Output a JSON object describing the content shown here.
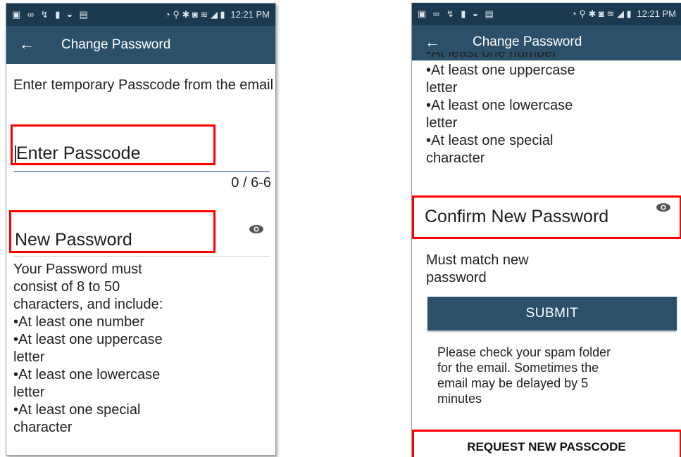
{
  "status_bar": {
    "left_icons": "▣ ∞ ↯ ▮ ◒ ▤",
    "right_icons": "◔ ⚲ ✱ ◙ ≋ ◢ ▮",
    "time": "12:21 PM"
  },
  "app_bar": {
    "back_icon": "←",
    "title": "Change Password"
  },
  "left_screen": {
    "instruction": "Enter temporary Passcode from the email",
    "passcode_placeholder": "Enter Passcode",
    "passcode_counter": "0 / 6-6",
    "new_password_placeholder": "New Password",
    "requirements": [
      "Your Password must",
      "consist of 8 to 50",
      "characters, and include:",
      "•At least one number",
      "•At least one uppercase",
      "letter",
      "•At least one lowercase",
      "letter",
      "•At least one special",
      "character"
    ]
  },
  "right_screen": {
    "scrolled_partial_line": "•At least one number",
    "requirements": [
      "•At least one uppercase",
      "letter",
      "•At least one lowercase",
      "letter",
      "•At least one special",
      "character"
    ],
    "confirm_placeholder": "Confirm New Password",
    "confirm_hint": [
      "Must match new",
      "password"
    ],
    "submit_label": "SUBMIT",
    "spam_note": [
      "Please check your spam folder",
      "for the email. Sometimes the",
      "email may be delayed by 5",
      "minutes"
    ],
    "request_label": "REQUEST NEW PASSCODE"
  },
  "colors": {
    "status_bar": "#1b394f",
    "app_bar": "#2c506a",
    "highlight": "#ff0000"
  }
}
